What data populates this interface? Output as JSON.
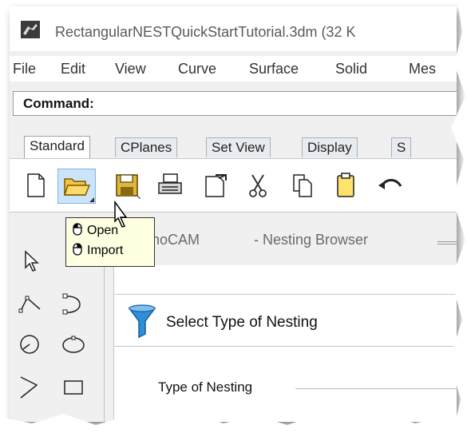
{
  "window": {
    "title": "RectangularNESTQuickStartTutorial.3dm (32 K"
  },
  "menu": {
    "items": [
      "File",
      "Edit",
      "View",
      "Curve",
      "Surface",
      "Solid",
      "Mes"
    ]
  },
  "command": {
    "label": "Command:"
  },
  "tabs": {
    "items": [
      "Standard",
      "CPlanes",
      "Set View",
      "Display",
      "S"
    ]
  },
  "tooltip": {
    "items": [
      "Open",
      "Import"
    ]
  },
  "panel": {
    "left_title": "noCAM",
    "right_title": "- Nesting Browser",
    "section_title": "Select Type of Nesting",
    "type_label": "Type of Nesting"
  },
  "colors": {
    "highlight": "#cce4f7",
    "tooltip_bg": "#ffffe1",
    "funnel": "#2f8fd6"
  }
}
